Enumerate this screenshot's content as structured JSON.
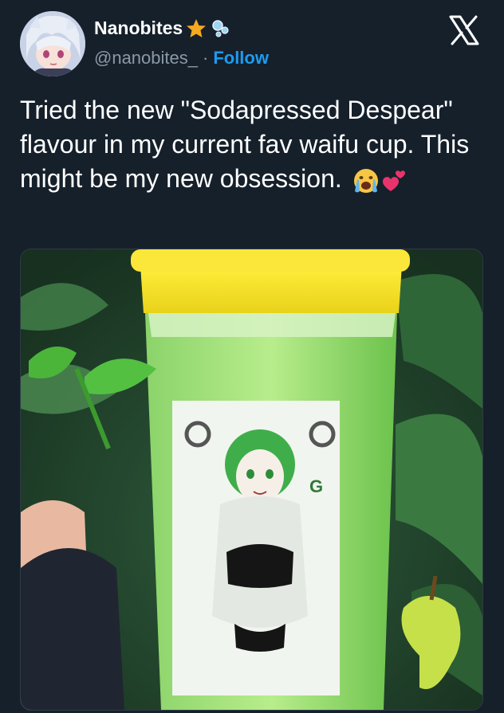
{
  "author": {
    "display_name": "Nanobites",
    "badges": [
      "star-emoji",
      "bubbles-emoji"
    ],
    "handle": "@nanobites_",
    "separator": "·",
    "follow_label": "Follow"
  },
  "platform_logo": "x-logo",
  "tweet": {
    "text": "Tried the new \"Sodapressed Despear\" flavour in my current fav waifu cup. This might be my new obsession.",
    "emojis": [
      "crying-face-emoji",
      "two-hearts-emoji"
    ]
  },
  "media": {
    "alt": "Photo of a green shaker cup with a yellow lid and an anime character printed on it, with a pear and leaf stickers",
    "cup_print_text": "G"
  },
  "colors": {
    "background": "#15202b",
    "text": "#ffffff",
    "secondary_text": "#8b98a5",
    "accent": "#1d9bf0"
  }
}
